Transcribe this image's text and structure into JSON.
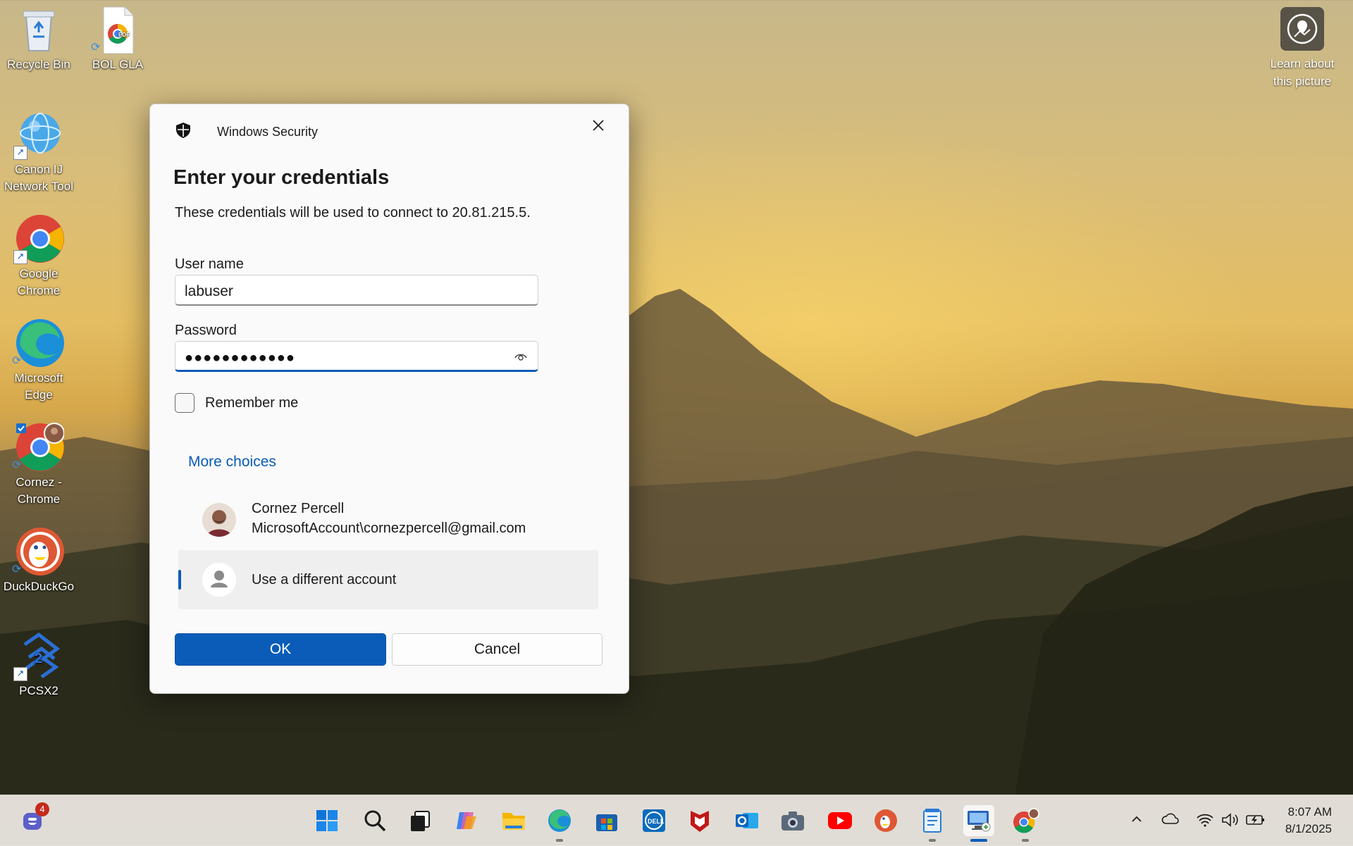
{
  "desktop": {
    "icons": [
      {
        "label": "Recycle Bin",
        "icon": "recycle-bin-icon"
      },
      {
        "label": "BOL GLA",
        "icon": "pdf-file-icon"
      },
      {
        "label": "Canon IJ Network Tool",
        "icon": "canon-network-tool-icon"
      },
      {
        "label": "Google Chrome",
        "icon": "chrome-icon"
      },
      {
        "label": "Microsoft Edge",
        "icon": "edge-icon"
      },
      {
        "label": "Cornez - Chrome",
        "icon": "chrome-profile-icon"
      },
      {
        "label": "DuckDuckGo",
        "icon": "duckduckgo-icon"
      },
      {
        "label": "PCSX2",
        "icon": "pcsx2-icon"
      }
    ],
    "learn_about": "Learn about this picture"
  },
  "dialog": {
    "window_title": "Windows Security",
    "heading": "Enter your credentials",
    "description": "These credentials will be used to connect to 20.81.215.5.",
    "username_label": "User name",
    "username_value": "labuser",
    "password_label": "Password",
    "password_masked": "●●●●●●●●●●●●",
    "remember_label": "Remember me",
    "remember_checked": false,
    "more_choices": "More choices",
    "accounts": [
      {
        "name": "Cornez Percell",
        "detail": "MicrosoftAccount\\cornezpercell@gmail.com"
      },
      {
        "name": "Use a different account",
        "selected": true
      }
    ],
    "ok_label": "OK",
    "cancel_label": "Cancel",
    "accent_color": "#0a5cb8"
  },
  "taskbar": {
    "teams_badge": "4",
    "pinned": [
      "start-icon",
      "search-icon",
      "task-view-icon",
      "copilot-icon",
      "file-explorer-icon",
      "edge-icon",
      "store-icon",
      "dell-icon",
      "mcafee-icon",
      "outlook-icon",
      "camera-icon",
      "youtube-icon",
      "duckduckgo-icon",
      "notepad-icon",
      "remote-desktop-icon",
      "chrome-icon"
    ],
    "time": "8:07 AM",
    "date": "8/1/2025"
  }
}
